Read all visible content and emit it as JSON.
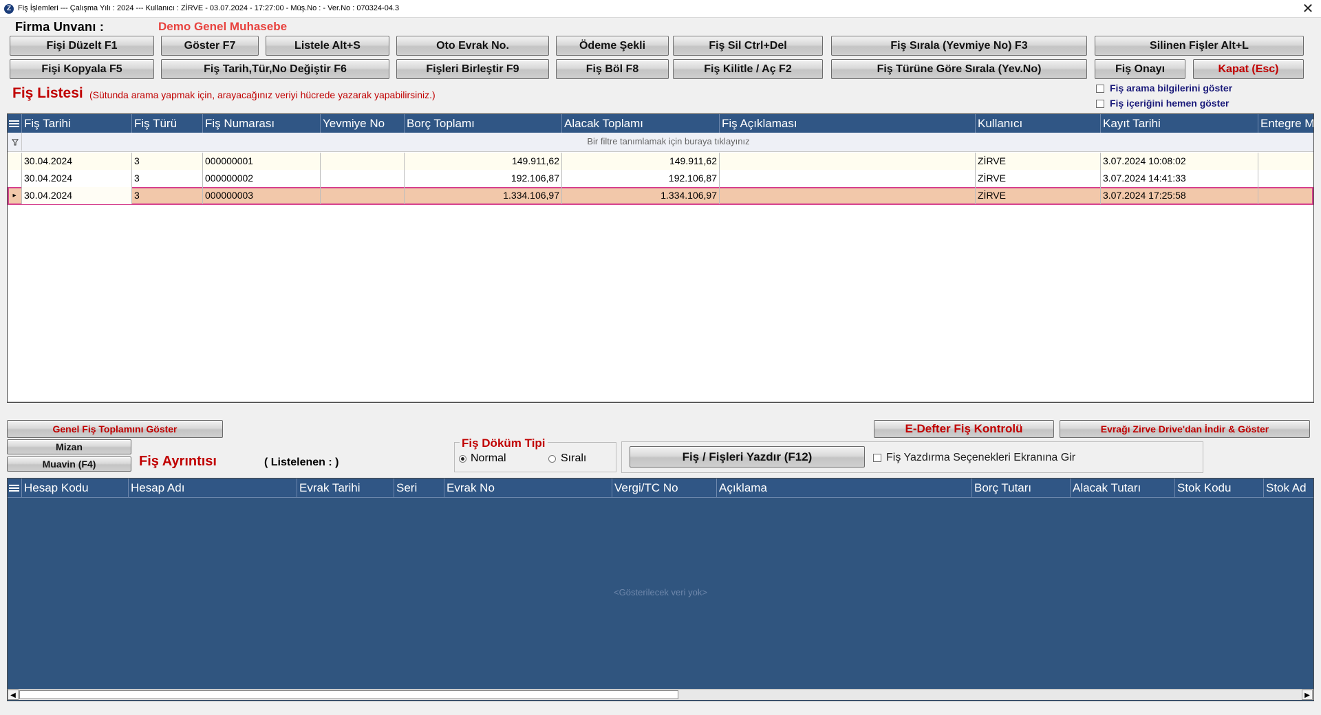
{
  "window": {
    "title": "Fiş İşlemleri  ---  Çalışma Yılı : 2024  ---  Kullanıcı : ZİRVE - 03.07.2024 - 17:27:00 - Müş.No :  - Ver.No : 070324-04.3",
    "close": "✕"
  },
  "firma": {
    "label": "Firma  Unvanı :",
    "value": "Demo Genel Muhasebe"
  },
  "toolbar": {
    "row1": [
      "Fişi Düzelt F1",
      "Göster F7",
      "Listele Alt+S",
      "Oto Evrak No.",
      "Ödeme Şekli",
      "Fiş Sil Ctrl+Del",
      "Fiş Sırala (Yevmiye No) F3",
      "Silinen Fişler Alt+L"
    ],
    "row2": [
      "Fişi Kopyala F5",
      "Fiş Tarih,Tür,No Değiştir F6",
      "Fişleri Birleştir F9",
      "Fiş Böl F8",
      "Fiş Kilitle / Aç F2",
      "Fiş Türüne Göre Sırala (Yev.No)",
      "Fiş Onayı",
      "Kapat (Esc)"
    ]
  },
  "fis_listesi": {
    "title": "Fiş Listesi",
    "hint": "(Sütunda arama yapmak için, arayacağınız veriyi hücrede yazarak yapabilirsiniz.)",
    "options": [
      "Fiş arama bilgilerini göster",
      "Fiş içeriğini hemen göster"
    ],
    "columns": [
      "Fiş Tarihi",
      "Fiş Türü",
      "Fiş Numarası",
      "Yevmiye No",
      "Borç Toplamı",
      "Alacak Toplamı",
      "Fiş Açıklaması",
      "Kullanıcı",
      "Kayıt Tarihi",
      "Entegre Mo"
    ],
    "filter_text": "Bir filtre tanımlamak için buraya tıklayınız",
    "rows": [
      [
        "30.04.2024",
        "3",
        "000000001",
        "",
        "149.911,62",
        "149.911,62",
        "",
        "ZİRVE",
        "3.07.2024 10:08:02",
        ""
      ],
      [
        "30.04.2024",
        "3",
        "000000002",
        "",
        "192.106,87",
        "192.106,87",
        "",
        "ZİRVE",
        "3.07.2024 14:41:33",
        ""
      ],
      [
        "30.04.2024",
        "3",
        "000000003",
        "",
        "1.334.106,97",
        "1.334.106,97",
        "",
        "ZİRVE",
        "3.07.2024 17:25:58",
        ""
      ]
    ],
    "selected_row": 2
  },
  "lower": {
    "genel_toplam": "Genel Fiş Toplamını Göster",
    "mizan": "Mizan",
    "muavin": "Muavin (F4)",
    "fis_ayrintisi": "Fiş Ayrıntısı",
    "listelenen": "( Listelenen : )",
    "dokum_title": "Fiş Döküm Tipi",
    "dokum_options": [
      "Normal",
      "Sıralı"
    ],
    "yazdir": "Fiş / Fişleri Yazdır (F12)",
    "yazdir_option": "Fiş Yazdırma Seçenekleri Ekranına Gir",
    "edefter": "E-Defter Fiş Kontrolü",
    "drive": "Evrağı Zirve Drive'dan İndir & Göster"
  },
  "detail_grid": {
    "columns": [
      "Hesap Kodu",
      "Hesap Adı",
      "Evrak Tarihi",
      "Seri",
      "Evrak No",
      "Vergi/TC No",
      "Açıklama",
      "Borç Tutarı",
      "Alacak Tutarı",
      "Stok Kodu",
      "Stok Ad"
    ],
    "empty_text": "<Gösterilecek veri yok>"
  },
  "colors": {
    "header_bg": "#305685",
    "selected_row": "#f2c8aa",
    "accent_red": "#c00000"
  }
}
